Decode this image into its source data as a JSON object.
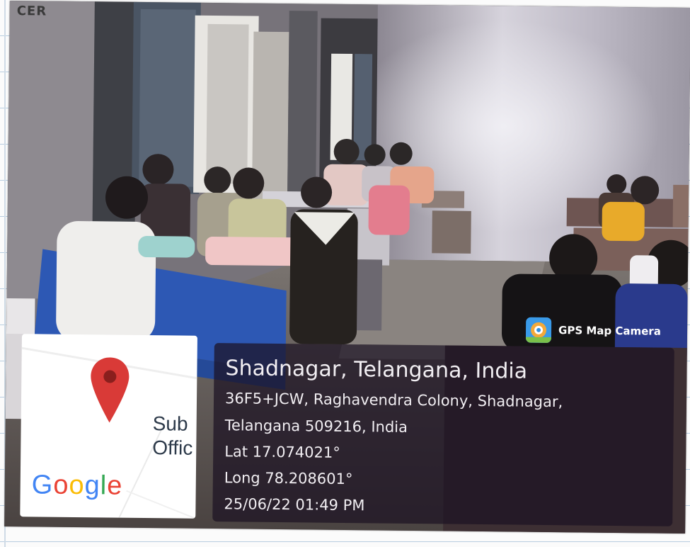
{
  "photo": {
    "corner_label": "CER"
  },
  "map_card": {
    "place_label_line1": "Sub",
    "place_label_line2": "Offic",
    "logo_text": [
      "G",
      "o",
      "o",
      "g",
      "l",
      "e"
    ],
    "logo_colors": [
      "#4285F4",
      "#EA4335",
      "#FBBC05",
      "#4285F4",
      "#34A853",
      "#EA4335"
    ],
    "pin_color": "#d93a37",
    "pin_icon": "map-pin-icon"
  },
  "badge": {
    "label": "GPS Map Camera",
    "icon": "gps-map-camera-icon"
  },
  "info": {
    "title": "Shadnagar, Telangana, India",
    "address_line1": "36F5+JCW, Raghavendra Colony, Shadnagar,",
    "address_line2": "Telangana 509216, India",
    "latitude": "Lat 17.074021°",
    "longitude": "Long 78.208601°",
    "timestamp": "25/06/22 01:49 PM"
  }
}
